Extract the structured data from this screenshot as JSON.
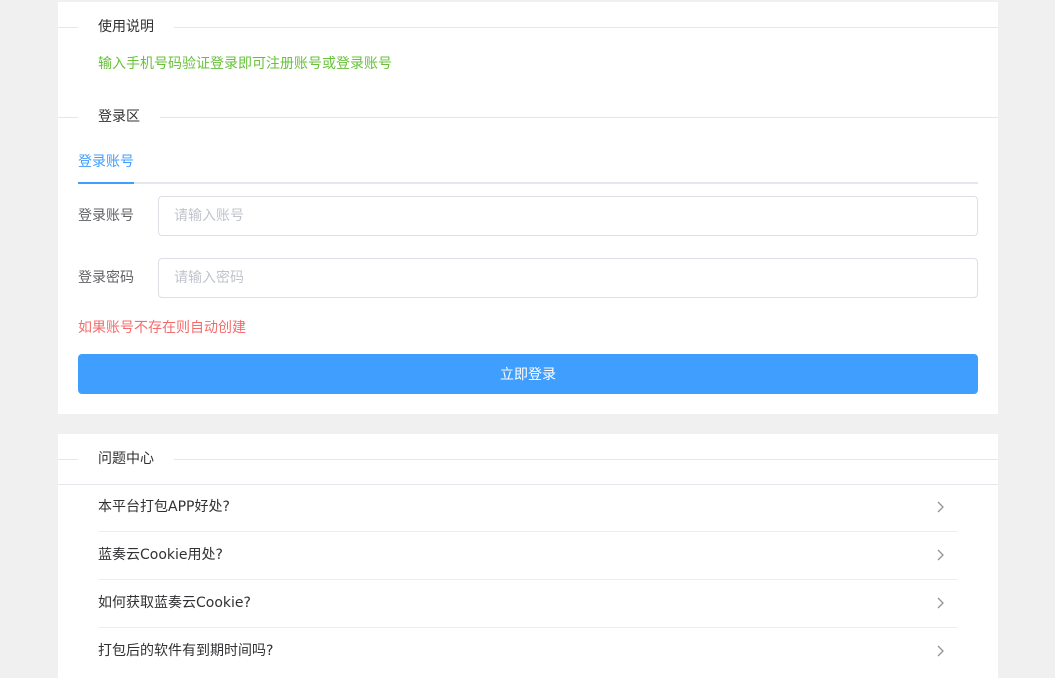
{
  "usage": {
    "section_title": "使用说明",
    "text": "输入手机号码验证登录即可注册账号或登录账号"
  },
  "login": {
    "section_title": "登录区",
    "tab_label": "登录账号",
    "account_label": "登录账号",
    "account_placeholder": "请输入账号",
    "password_label": "登录密码",
    "password_placeholder": "请输入密码",
    "hint": "如果账号不存在则自动创建",
    "submit_label": "立即登录"
  },
  "faq": {
    "section_title": "问题中心",
    "items": [
      {
        "label": "本平台打包APP好处?"
      },
      {
        "label": "蓝奏云Cookie用处?"
      },
      {
        "label": "如何获取蓝奏云Cookie?"
      },
      {
        "label": "打包后的软件有到期时间吗?"
      }
    ]
  },
  "colors": {
    "page_bg": "#f0f0f0",
    "primary": "#409eff",
    "success_text": "#67c23a",
    "danger_text": "#f56c6c"
  },
  "icons": {
    "faq_item_icon": "chevron-right-icon"
  }
}
